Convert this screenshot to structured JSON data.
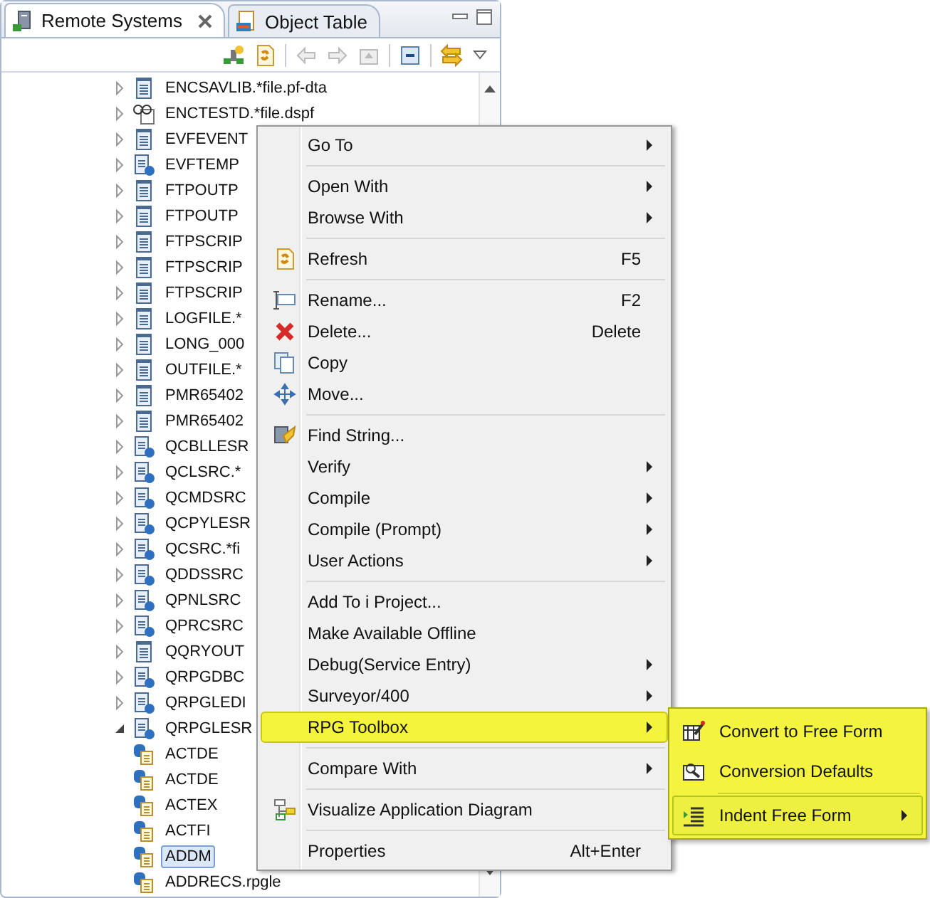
{
  "tabs": [
    {
      "label": "Remote Systems",
      "selected": true,
      "closable": true
    },
    {
      "label": "Object Table",
      "selected": false,
      "closable": false
    }
  ],
  "tree": [
    {
      "label": "ENCSAVLIB.*file.pf-dta",
      "kind": "pf",
      "expanded": false,
      "selected": false
    },
    {
      "label": "ENCTESTD.*file.dspf",
      "kind": "dspf",
      "expanded": false,
      "selected": false
    },
    {
      "label": "EVFEVENT",
      "kind": "pf",
      "expanded": false,
      "selected": false
    },
    {
      "label": "EVFTEMP",
      "kind": "src",
      "expanded": false,
      "selected": false
    },
    {
      "label": "FTPOUTP",
      "kind": "pf",
      "expanded": false,
      "selected": false
    },
    {
      "label": "FTPOUTP",
      "kind": "pf",
      "expanded": false,
      "selected": false
    },
    {
      "label": "FTPSCRIP",
      "kind": "pf",
      "expanded": false,
      "selected": false
    },
    {
      "label": "FTPSCRIP",
      "kind": "pf",
      "expanded": false,
      "selected": false
    },
    {
      "label": "FTPSCRIP",
      "kind": "pf",
      "expanded": false,
      "selected": false
    },
    {
      "label": "LOGFILE.*",
      "kind": "pf",
      "expanded": false,
      "selected": false
    },
    {
      "label": "LONG_000",
      "kind": "pf",
      "expanded": false,
      "selected": false
    },
    {
      "label": "OUTFILE.*",
      "kind": "pf",
      "expanded": false,
      "selected": false
    },
    {
      "label": "PMR65402",
      "kind": "pf",
      "expanded": false,
      "selected": false
    },
    {
      "label": "PMR65402",
      "kind": "pf",
      "expanded": false,
      "selected": false
    },
    {
      "label": "QCBLLESR",
      "kind": "src",
      "expanded": false,
      "selected": false
    },
    {
      "label": "QCLSRC.*",
      "kind": "src",
      "expanded": false,
      "selected": false
    },
    {
      "label": "QCMDSRC",
      "kind": "src",
      "expanded": false,
      "selected": false
    },
    {
      "label": "QCPYLESR",
      "kind": "src",
      "expanded": false,
      "selected": false
    },
    {
      "label": "QCSRC.*fi",
      "kind": "src",
      "expanded": false,
      "selected": false
    },
    {
      "label": "QDDSSRC",
      "kind": "src",
      "expanded": false,
      "selected": false
    },
    {
      "label": "QPNLSRC",
      "kind": "src",
      "expanded": false,
      "selected": false
    },
    {
      "label": "QPRCSRC",
      "kind": "src",
      "expanded": false,
      "selected": false
    },
    {
      "label": "QQRYOUT",
      "kind": "pf",
      "expanded": false,
      "selected": false
    },
    {
      "label": "QRPGDBC",
      "kind": "src",
      "expanded": false,
      "selected": false
    },
    {
      "label": "QRPGLEDI",
      "kind": "src",
      "expanded": false,
      "selected": false
    },
    {
      "label": "QRPGLESR",
      "kind": "src",
      "expanded": true,
      "selected": false,
      "children": [
        {
          "label": "ACTDE",
          "kind": "member",
          "selected": false
        },
        {
          "label": "ACTDE",
          "kind": "member",
          "selected": false
        },
        {
          "label": "ACTEX",
          "kind": "member",
          "selected": false
        },
        {
          "label": "ACTFI",
          "kind": "member",
          "selected": false
        },
        {
          "label": "ADDM",
          "kind": "member",
          "selected": true
        },
        {
          "label": "ADDRECS.rpgle",
          "kind": "member",
          "selected": false
        }
      ]
    }
  ],
  "context_menu": [
    {
      "kind": "plain",
      "label": "Go To",
      "submenu": true,
      "selected": false
    },
    {
      "kind": "separator"
    },
    {
      "kind": "plain",
      "label": "Open With",
      "submenu": true,
      "selected": false
    },
    {
      "kind": "plain",
      "label": "Browse With",
      "submenu": true,
      "selected": false
    },
    {
      "kind": "separator"
    },
    {
      "kind": "refresh",
      "label": "Refresh",
      "shortcut": "F5",
      "submenu": false,
      "selected": false
    },
    {
      "kind": "separator"
    },
    {
      "kind": "rename",
      "label": "Rename...",
      "shortcut": "F2",
      "submenu": false,
      "selected": false
    },
    {
      "kind": "delete",
      "label": "Delete...",
      "shortcut": "Delete",
      "submenu": false,
      "selected": false
    },
    {
      "kind": "copy",
      "label": "Copy",
      "submenu": false,
      "selected": false
    },
    {
      "kind": "move",
      "label": "Move...",
      "submenu": false,
      "selected": false
    },
    {
      "kind": "separator"
    },
    {
      "kind": "find",
      "label": "Find String...",
      "submenu": false,
      "selected": false
    },
    {
      "kind": "plain",
      "label": "Verify",
      "submenu": true,
      "selected": false
    },
    {
      "kind": "plain",
      "label": "Compile",
      "submenu": true,
      "selected": false
    },
    {
      "kind": "plain",
      "label": "Compile (Prompt)",
      "submenu": true,
      "selected": false
    },
    {
      "kind": "plain",
      "label": "User Actions",
      "submenu": true,
      "selected": false
    },
    {
      "kind": "separator"
    },
    {
      "kind": "plain",
      "label": "Add To i Project...",
      "submenu": false,
      "selected": false
    },
    {
      "kind": "plain",
      "label": "Make Available Offline",
      "submenu": false,
      "selected": false
    },
    {
      "kind": "plain",
      "label": "Debug(Service Entry)",
      "submenu": true,
      "selected": false
    },
    {
      "kind": "plain",
      "label": "Surveyor/400",
      "submenu": true,
      "selected": false
    },
    {
      "kind": "plain",
      "label": "RPG Toolbox",
      "submenu": true,
      "selected": true
    },
    {
      "kind": "separator"
    },
    {
      "kind": "plain",
      "label": "Compare With",
      "submenu": true,
      "selected": false
    },
    {
      "kind": "separator"
    },
    {
      "kind": "diagram",
      "label": "Visualize Application Diagram",
      "submenu": false,
      "selected": false
    },
    {
      "kind": "separator"
    },
    {
      "kind": "plain",
      "label": "Properties",
      "shortcut": "Alt+Enter",
      "submenu": false,
      "selected": false
    }
  ],
  "submenu": [
    {
      "kind": "convert",
      "label": "Convert to Free Form",
      "submenu": false,
      "selected": false
    },
    {
      "kind": "defaults",
      "label": "Conversion Defaults",
      "submenu": false,
      "selected": false
    },
    {
      "kind": "separator"
    },
    {
      "kind": "indent",
      "label": "Indent Free Form",
      "submenu": true,
      "selected": true
    }
  ]
}
